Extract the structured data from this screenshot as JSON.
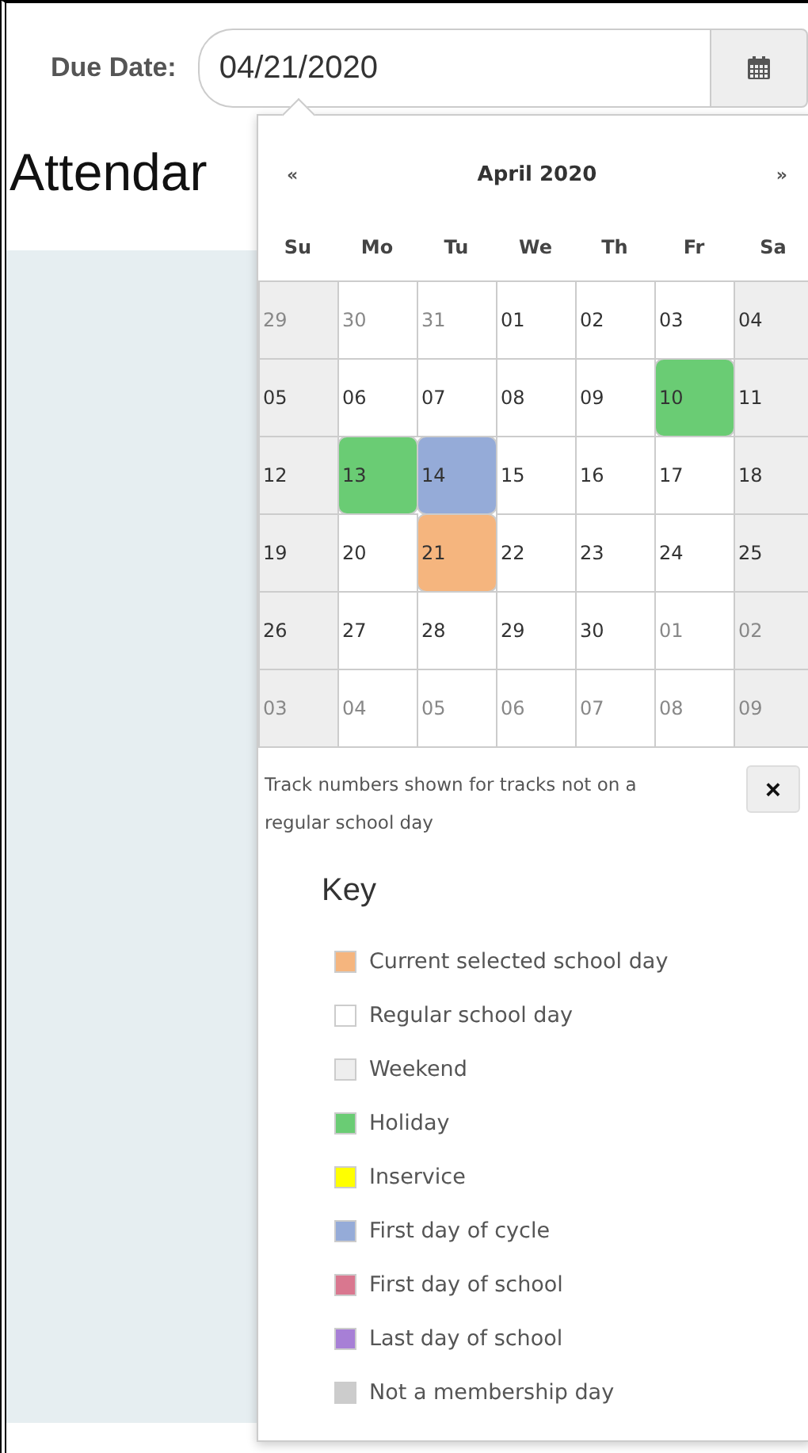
{
  "due_date": {
    "label": "Due Date:",
    "value": "04/21/2020"
  },
  "heading": "Attendar",
  "calendar": {
    "prev": "«",
    "title": "April 2020",
    "next": "»",
    "weekdays": [
      "Su",
      "Mo",
      "Tu",
      "We",
      "Th",
      "Fr",
      "Sa"
    ],
    "weeks": [
      [
        {
          "day": "29",
          "kind": "weekend",
          "outside": true
        },
        {
          "day": "30",
          "kind": "regular",
          "outside": true
        },
        {
          "day": "31",
          "kind": "regular",
          "outside": true
        },
        {
          "day": "01",
          "kind": "regular",
          "outside": false
        },
        {
          "day": "02",
          "kind": "regular",
          "outside": false
        },
        {
          "day": "03",
          "kind": "regular",
          "outside": false
        },
        {
          "day": "04",
          "kind": "weekend",
          "outside": false
        }
      ],
      [
        {
          "day": "05",
          "kind": "weekend",
          "outside": false
        },
        {
          "day": "06",
          "kind": "regular",
          "outside": false
        },
        {
          "day": "07",
          "kind": "regular",
          "outside": false
        },
        {
          "day": "08",
          "kind": "regular",
          "outside": false
        },
        {
          "day": "09",
          "kind": "regular",
          "outside": false
        },
        {
          "day": "10",
          "kind": "holiday",
          "outside": false
        },
        {
          "day": "11",
          "kind": "weekend",
          "outside": false
        }
      ],
      [
        {
          "day": "12",
          "kind": "weekend",
          "outside": false
        },
        {
          "day": "13",
          "kind": "holiday",
          "outside": false
        },
        {
          "day": "14",
          "kind": "cycle",
          "outside": false
        },
        {
          "day": "15",
          "kind": "regular",
          "outside": false
        },
        {
          "day": "16",
          "kind": "regular",
          "outside": false
        },
        {
          "day": "17",
          "kind": "regular",
          "outside": false
        },
        {
          "day": "18",
          "kind": "weekend",
          "outside": false
        }
      ],
      [
        {
          "day": "19",
          "kind": "weekend",
          "outside": false
        },
        {
          "day": "20",
          "kind": "regular",
          "outside": false
        },
        {
          "day": "21",
          "kind": "selected",
          "outside": false
        },
        {
          "day": "22",
          "kind": "regular",
          "outside": false
        },
        {
          "day": "23",
          "kind": "regular",
          "outside": false
        },
        {
          "day": "24",
          "kind": "regular",
          "outside": false
        },
        {
          "day": "25",
          "kind": "weekend",
          "outside": false
        }
      ],
      [
        {
          "day": "26",
          "kind": "weekend",
          "outside": false
        },
        {
          "day": "27",
          "kind": "regular",
          "outside": false
        },
        {
          "day": "28",
          "kind": "regular",
          "outside": false
        },
        {
          "day": "29",
          "kind": "regular",
          "outside": false
        },
        {
          "day": "30",
          "kind": "regular",
          "outside": false
        },
        {
          "day": "01",
          "kind": "regular",
          "outside": true
        },
        {
          "day": "02",
          "kind": "weekend",
          "outside": true
        }
      ],
      [
        {
          "day": "03",
          "kind": "weekend",
          "outside": true
        },
        {
          "day": "04",
          "kind": "regular",
          "outside": true
        },
        {
          "day": "05",
          "kind": "regular",
          "outside": true
        },
        {
          "day": "06",
          "kind": "regular",
          "outside": true
        },
        {
          "day": "07",
          "kind": "regular",
          "outside": true
        },
        {
          "day": "08",
          "kind": "regular",
          "outside": true
        },
        {
          "day": "09",
          "kind": "weekend",
          "outside": true
        }
      ]
    ],
    "note": "Track numbers shown for tracks not on a regular school day",
    "close": "×"
  },
  "key": {
    "title": "Key",
    "items": [
      {
        "label": "Current selected school day",
        "color": "#f5b57e"
      },
      {
        "label": "Regular school day",
        "color": "#ffffff"
      },
      {
        "label": "Weekend",
        "color": "#eeeeee"
      },
      {
        "label": "Holiday",
        "color": "#6acc74"
      },
      {
        "label": "Inservice",
        "color": "#ffff00"
      },
      {
        "label": "First day of cycle",
        "color": "#95abd8"
      },
      {
        "label": "First day of school",
        "color": "#d9778f"
      },
      {
        "label": "Last day of school",
        "color": "#a77fd6"
      },
      {
        "label": "Not a membership day",
        "color": "#cccccc"
      }
    ]
  }
}
